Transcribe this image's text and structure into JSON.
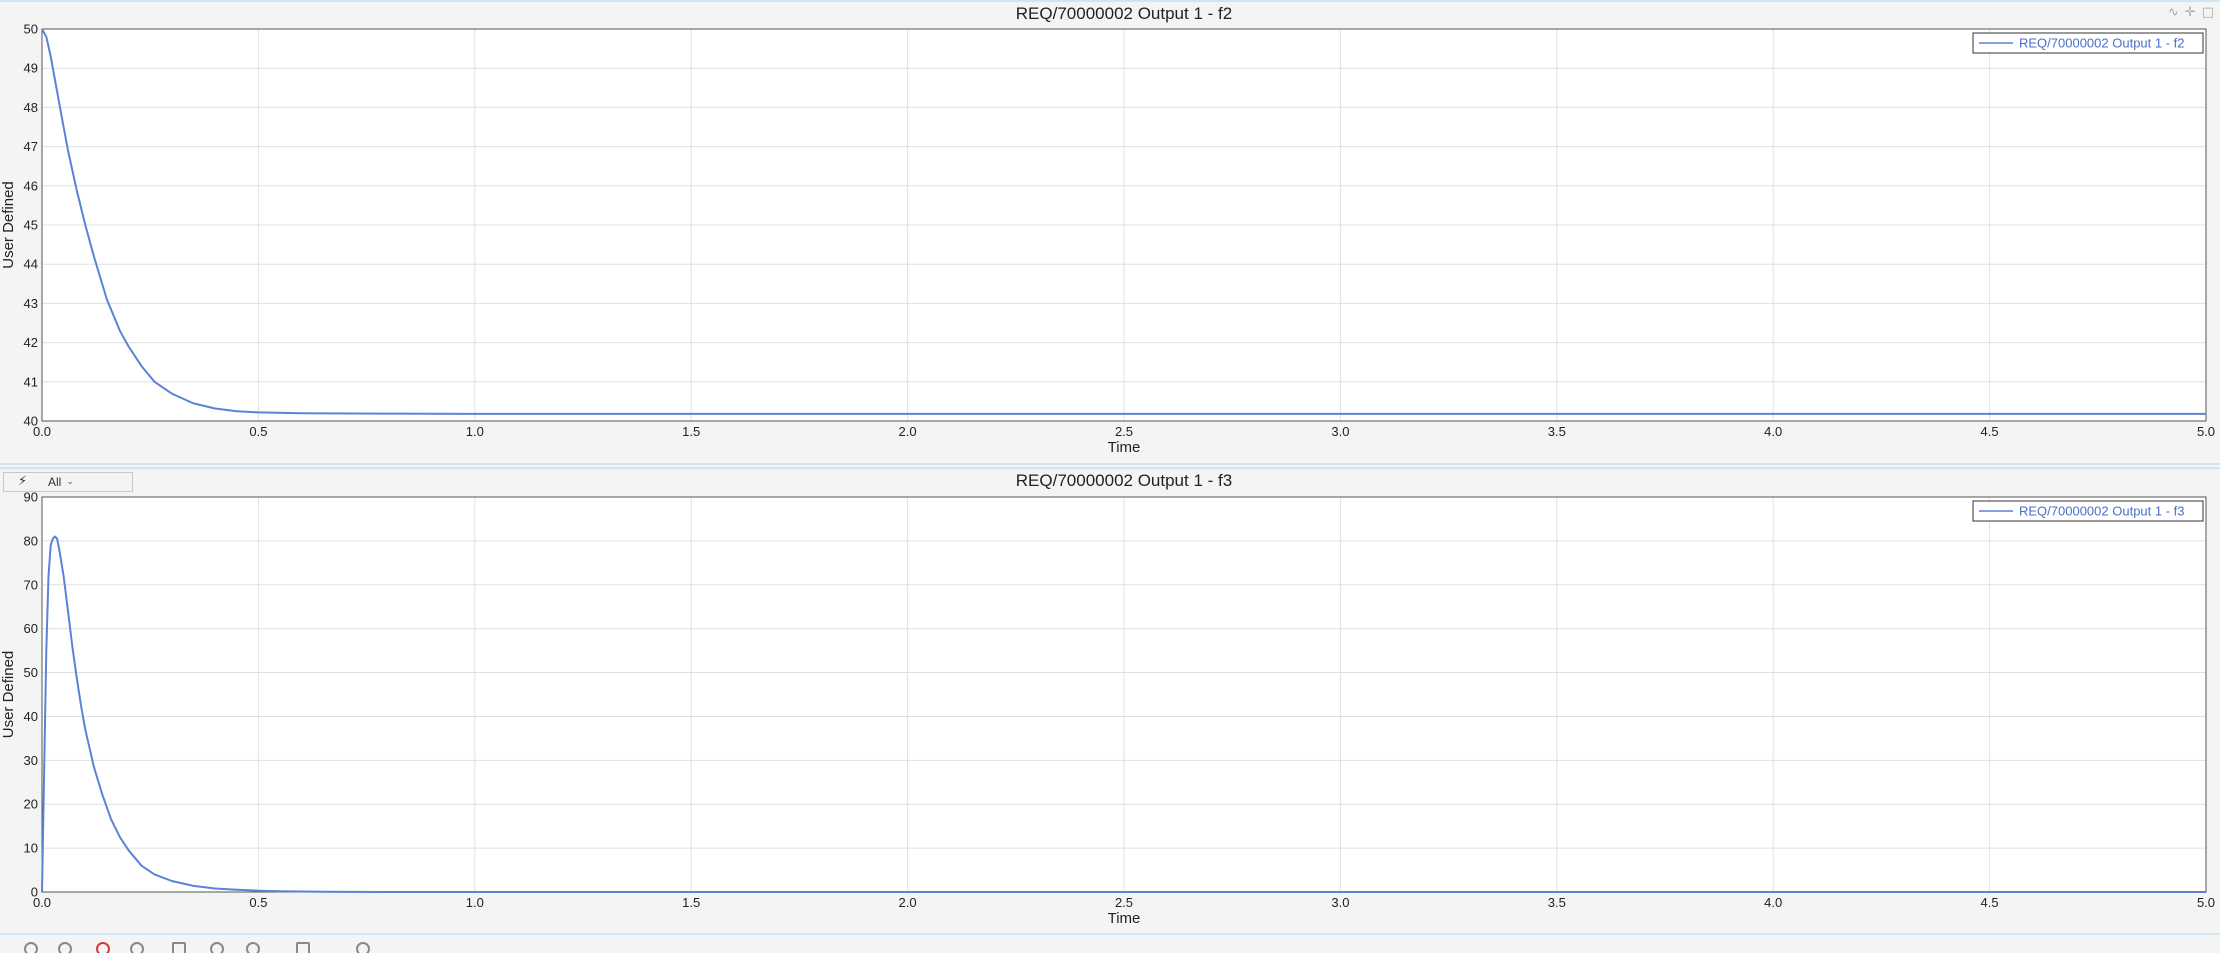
{
  "window_controls": {
    "icons": [
      "restore-icon",
      "move-icon",
      "maximize-icon"
    ],
    "glyphs": [
      "∿",
      "✛",
      "□"
    ]
  },
  "filter": {
    "label": "All",
    "icon": "lightning-icon",
    "bolt": "⚡",
    "chevron": "⌄"
  },
  "colors": {
    "series": "#5b82d6",
    "legend_text": "#4a6fc8",
    "grid": "#e0e0e0",
    "axis": "#555555",
    "text": "#222222"
  },
  "bottom_toolbar": {
    "icons": [
      "undo-icon",
      "pen-icon",
      "bomb-icon",
      "help-icon",
      "window-icon",
      "link-icon",
      "audio-icon",
      "square-icon",
      "clock-icon"
    ]
  },
  "chart_data": [
    {
      "type": "line",
      "title": "REQ/70000002 Output 1 - f2",
      "xlabel": "Time",
      "ylabel": "User Defined",
      "xlim": [
        0,
        5
      ],
      "ylim": [
        40,
        50
      ],
      "xticks": [
        "0.0",
        "0.5",
        "1.0",
        "1.5",
        "2.0",
        "2.5",
        "3.0",
        "3.5",
        "4.0",
        "4.5",
        "5.0"
      ],
      "yticks": [
        "40",
        "41",
        "42",
        "43",
        "44",
        "45",
        "46",
        "47",
        "48",
        "49",
        "50"
      ],
      "grid": true,
      "legend_position": "top-right",
      "series": [
        {
          "name": "REQ/70000002 Output 1 - f2",
          "x": [
            0,
            0.01,
            0.02,
            0.03,
            0.04,
            0.05,
            0.06,
            0.08,
            0.1,
            0.12,
            0.15,
            0.18,
            0.2,
            0.23,
            0.26,
            0.3,
            0.35,
            0.4,
            0.45,
            0.5,
            0.6,
            0.8,
            1.0,
            2.0,
            3.0,
            4.0,
            5.0
          ],
          "y": [
            50.0,
            49.8,
            49.3,
            48.7,
            48.1,
            47.5,
            46.9,
            45.9,
            45.0,
            44.2,
            43.1,
            42.3,
            41.9,
            41.4,
            41.0,
            40.7,
            40.45,
            40.32,
            40.25,
            40.22,
            40.2,
            40.19,
            40.18,
            40.18,
            40.18,
            40.18,
            40.18
          ]
        }
      ]
    },
    {
      "type": "line",
      "title": "REQ/70000002 Output 1 - f3",
      "xlabel": "Time",
      "ylabel": "User Defined",
      "xlim": [
        0,
        5
      ],
      "ylim": [
        0,
        90
      ],
      "xticks": [
        "0.0",
        "0.5",
        "1.0",
        "1.5",
        "2.0",
        "2.5",
        "3.0",
        "3.5",
        "4.0",
        "4.5",
        "5.0"
      ],
      "yticks": [
        "0",
        "10",
        "20",
        "30",
        "40",
        "50",
        "60",
        "70",
        "80",
        "90"
      ],
      "grid": true,
      "legend_position": "top-right",
      "series": [
        {
          "name": "REQ/70000002 Output 1 - f3",
          "x": [
            0,
            0.01,
            0.015,
            0.02,
            0.025,
            0.03,
            0.035,
            0.04,
            0.05,
            0.06,
            0.07,
            0.08,
            0.09,
            0.1,
            0.12,
            0.14,
            0.16,
            0.18,
            0.2,
            0.23,
            0.26,
            0.3,
            0.35,
            0.4,
            0.45,
            0.5,
            0.55,
            0.65,
            0.8,
            1.0,
            2.0,
            3.0,
            4.0,
            5.0
          ],
          "y": [
            0,
            55,
            72,
            79,
            80.5,
            81,
            80.5,
            78,
            72,
            64,
            56,
            49,
            42.5,
            37,
            28.5,
            22,
            16.5,
            12.5,
            9.5,
            6,
            4,
            2.5,
            1.4,
            0.8,
            0.5,
            0.3,
            0.15,
            0.05,
            0,
            0,
            0,
            0,
            0,
            0
          ]
        }
      ]
    }
  ]
}
